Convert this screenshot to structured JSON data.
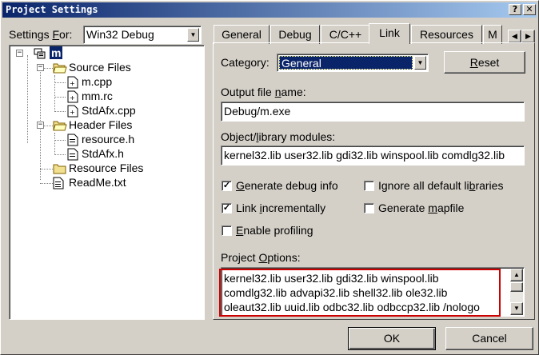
{
  "window": {
    "title": "Project Settings",
    "help_glyph": "?",
    "close_glyph": "✕"
  },
  "left": {
    "settings_for_prefix": "Settings ",
    "settings_for_underlined": "F",
    "settings_for_suffix": "or:",
    "config_value": "Win32 Debug",
    "tree": {
      "project": "m",
      "source_files": "Source Files",
      "source_children": [
        "m.cpp",
        "mm.rc",
        "StdAfx.cpp"
      ],
      "header_files": "Header Files",
      "header_children": [
        "resource.h",
        "StdAfx.h"
      ],
      "resource_files": "Resource Files",
      "readme": "ReadMe.txt"
    }
  },
  "tabs": {
    "items": [
      "General",
      "Debug",
      "C/C++",
      "Link",
      "Resources",
      "M"
    ],
    "active": "Link",
    "scroll_left": "◀",
    "scroll_right": "▶"
  },
  "link": {
    "category_prefix": "Cate",
    "category_underlined": "g",
    "category_suffix": "ory:",
    "category_value": "General",
    "reset_label_underlined": "R",
    "reset_label_rest": "eset",
    "output_label_prefix": "Output file ",
    "output_label_underlined": "n",
    "output_label_suffix": "ame:",
    "output_value": "Debug/m.exe",
    "modules_label_prefix": "Object/",
    "modules_label_underlined": "l",
    "modules_label_suffix": "ibrary modules:",
    "modules_value": "kernel32.lib user32.lib gdi32.lib winspool.lib comdlg32.lib",
    "checkboxes": {
      "debug_info": {
        "label_prefix": "",
        "label_u": "G",
        "label_suffix": "enerate debug info",
        "checked": true
      },
      "ignore_libs": {
        "label_prefix": "Ignore all default li",
        "label_u": "b",
        "label_suffix": "raries",
        "checked": false
      },
      "link_incremental": {
        "label_prefix": "Link ",
        "label_u": "i",
        "label_suffix": "ncrementally",
        "checked": true
      },
      "mapfile": {
        "label_prefix": "Generate ",
        "label_u": "m",
        "label_suffix": "apfile",
        "checked": false
      },
      "profiling": {
        "label_prefix": "",
        "label_u": "E",
        "label_suffix": "nable profiling",
        "checked": false
      }
    },
    "project_options_prefix": "Project ",
    "project_options_underlined": "O",
    "project_options_suffix": "ptions:",
    "project_options_lines": [
      "kernel32.lib user32.lib gdi32.lib winspool.lib",
      "comdlg32.lib advapi32.lib shell32.lib ole32.lib",
      "oleaut32.lib uuid.lib odbc32.lib odbccp32.lib /nologo"
    ],
    "highlight_color": "#cc0000"
  },
  "footer": {
    "ok_label": "OK",
    "cancel_label": "Cancel"
  },
  "colors": {
    "selection": "#0a246a",
    "face": "#d4d0c8"
  }
}
